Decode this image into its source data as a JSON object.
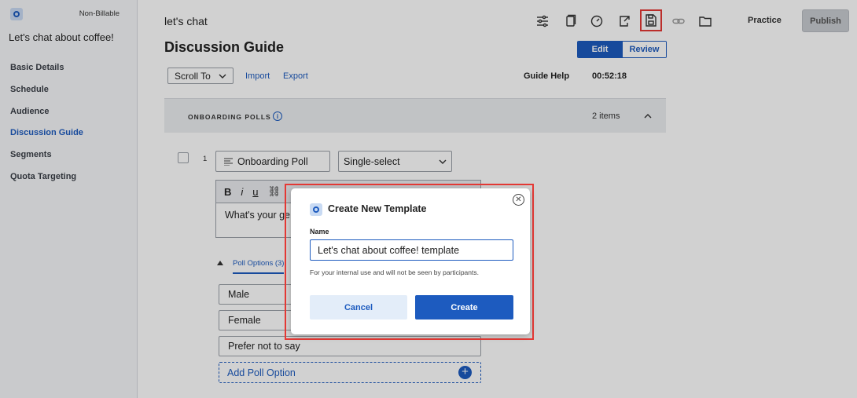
{
  "sidebar": {
    "billing_badge": "Non-Billable",
    "project_name": "Let's chat about coffee!",
    "items": [
      {
        "label": "Basic Details",
        "active": false
      },
      {
        "label": "Schedule",
        "active": false
      },
      {
        "label": "Audience",
        "active": false
      },
      {
        "label": "Discussion Guide",
        "active": true
      },
      {
        "label": "Segments",
        "active": false
      },
      {
        "label": "Quota Targeting",
        "active": false
      }
    ]
  },
  "header": {
    "title": "let's chat",
    "icons": [
      "sliders-icon",
      "copy-icon",
      "speed-icon",
      "export-icon",
      "save-template-icon",
      "link-icon",
      "folder-icon"
    ],
    "practice_label": "Practice",
    "publish_label": "Publish"
  },
  "guide": {
    "heading": "Discussion Guide",
    "edit_label": "Edit",
    "review_label": "Review",
    "scroll_to_label": "Scroll To",
    "import_label": "Import",
    "export_label": "Export",
    "help_label": "Guide Help",
    "timer": "00:52:18"
  },
  "section": {
    "title": "ONBOARDING POLLS",
    "count": "2 items"
  },
  "question": {
    "number": "1",
    "type_label": "Onboarding Poll",
    "select_value": "Single-select",
    "text": "What's your ge",
    "toolbar": {
      "bold": "B",
      "italic": "i",
      "underline": "u"
    },
    "poll_tab": "Poll Options (3)",
    "options": [
      "Male",
      "Female",
      "Prefer not to say"
    ],
    "add_option_label": "Add Poll Option"
  },
  "modal": {
    "title": "Create New Template",
    "name_label": "Name",
    "name_value": "Let's chat about coffee! template",
    "helper": "For your internal use and will not be seen by participants.",
    "cancel_label": "Cancel",
    "create_label": "Create"
  },
  "colors": {
    "accent": "#1d5bbf",
    "highlight": "#e53935"
  }
}
